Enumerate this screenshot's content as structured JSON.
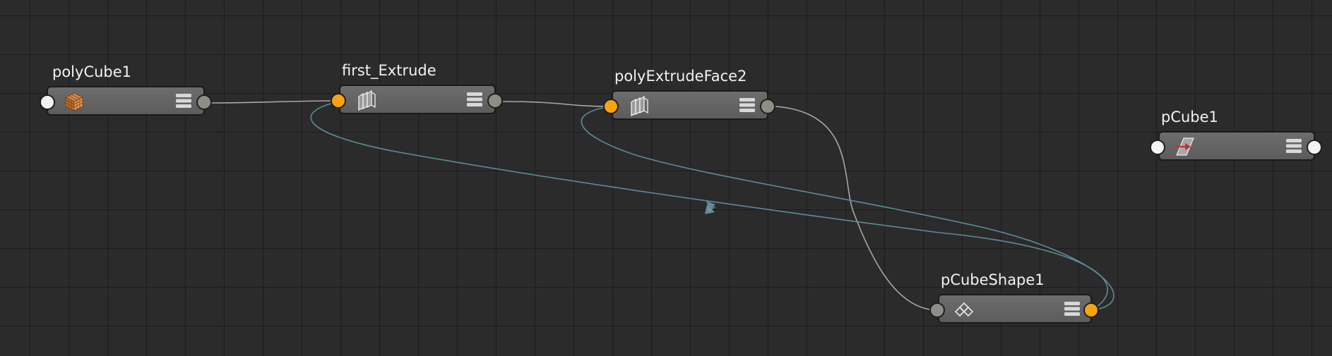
{
  "node_editor": {
    "nodes": [
      {
        "id": "polyCube1",
        "title": "polyCube1",
        "icon": "poly-cube-icon"
      },
      {
        "id": "first_Extrude",
        "title": "first_Extrude",
        "icon": "extrude-faces-icon"
      },
      {
        "id": "polyExtrudeFace2",
        "title": "polyExtrudeFace2",
        "icon": "extrude-faces-icon"
      },
      {
        "id": "pCube1",
        "title": "pCube1",
        "icon": "transform-icon"
      },
      {
        "id": "pCubeShape1",
        "title": "pCubeShape1",
        "icon": "shape-icon"
      }
    ],
    "connections": [
      {
        "from": "polyCube1",
        "to": "first_Extrude",
        "type": "input"
      },
      {
        "from": "first_Extrude",
        "to": "polyExtrudeFace2",
        "type": "input"
      },
      {
        "from": "polyExtrudeFace2",
        "to": "pCubeShape1",
        "type": "input"
      },
      {
        "from": "pCubeShape1",
        "to": "first_Extrude",
        "type": "history"
      },
      {
        "from": "pCubeShape1",
        "to": "polyExtrudeFace2",
        "type": "history"
      }
    ],
    "colors": {
      "background": "#2b2b2b",
      "grid_line": "#1c1c1c",
      "node_body": "#656565",
      "port_orange": "#f5a312",
      "port_grey": "#8d8f86",
      "port_white": "#f4f4f4",
      "wire_input": "#a7aaa0",
      "wire_history": "#5d8c9a"
    }
  }
}
